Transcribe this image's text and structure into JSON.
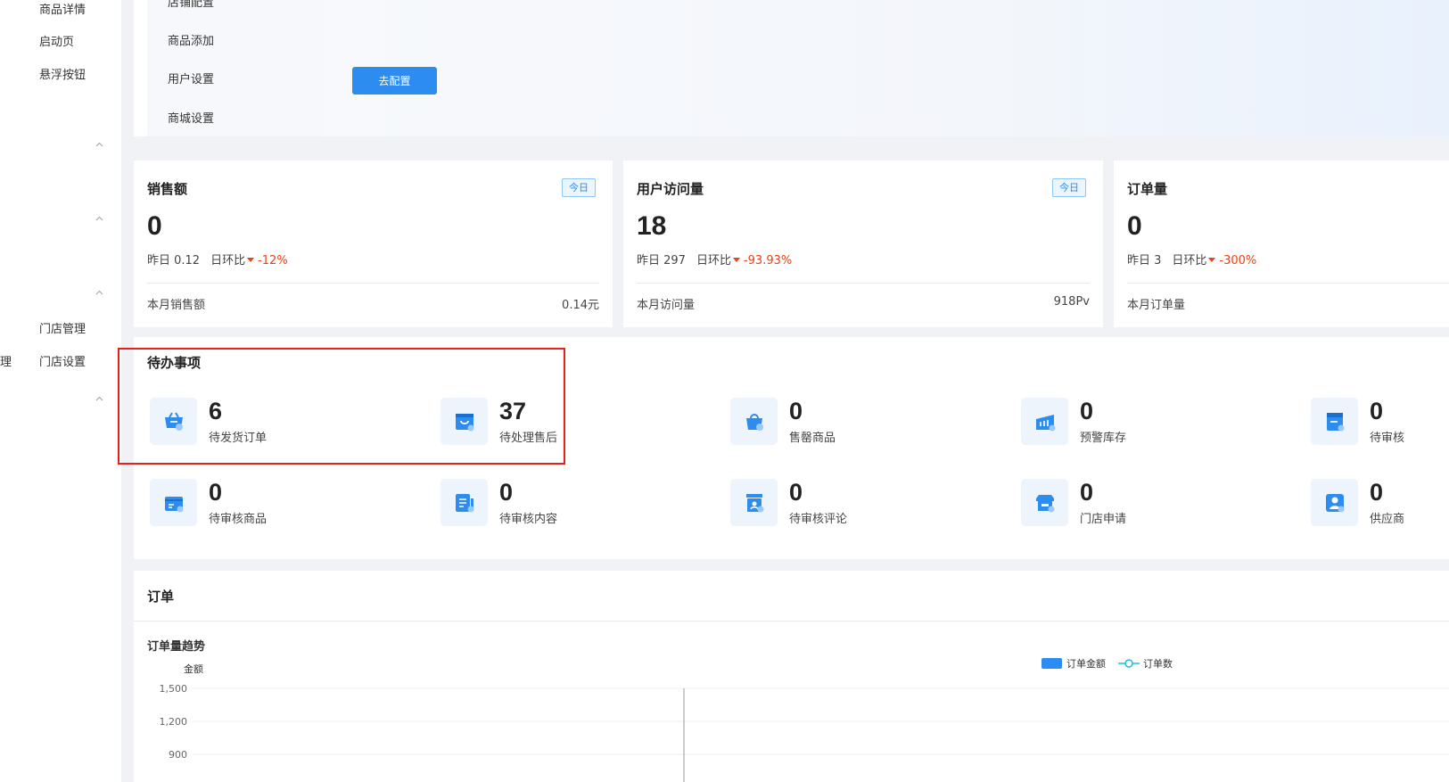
{
  "sidebar": {
    "items": [
      "商品详情",
      "启动页",
      "悬浮按钮",
      "门店管理",
      "门店设置"
    ],
    "cut_item": "理"
  },
  "config": {
    "menu": [
      "店铺配置",
      "商品添加",
      "用户设置",
      "商城设置"
    ],
    "button": "去配置"
  },
  "stats": [
    {
      "title": "销售额",
      "tag": "今日",
      "value": "0",
      "yesterday": "昨日 0.12",
      "ratio_label": "日环比",
      "ratio": "-12%",
      "foot_label": "本月销售额",
      "foot_value": "0.14元"
    },
    {
      "title": "用户访问量",
      "tag": "今日",
      "value": "18",
      "yesterday": "昨日 297",
      "ratio_label": "日环比",
      "ratio": "-93.93%",
      "foot_label": "本月访问量",
      "foot_value": "918Pv"
    },
    {
      "title": "订单量",
      "value": "0",
      "yesterday": "昨日 3",
      "ratio_label": "日环比",
      "ratio": "-300%",
      "foot_label": "本月订单量"
    }
  ],
  "todo": {
    "title": "待办事项",
    "items": [
      {
        "num": "6",
        "label": "待发货订单",
        "icon": "cart-icon"
      },
      {
        "num": "37",
        "label": "待处理售后",
        "icon": "bag-icon"
      },
      {
        "num": "0",
        "label": "售罄商品",
        "icon": "basket-icon"
      },
      {
        "num": "0",
        "label": "预警库存",
        "icon": "warehouse-icon"
      },
      {
        "num": "0",
        "label": "待审核",
        "icon": "document-icon"
      },
      {
        "num": "0",
        "label": "待审核商品",
        "icon": "product-box-icon"
      },
      {
        "num": "0",
        "label": "待审核内容",
        "icon": "content-icon"
      },
      {
        "num": "0",
        "label": "待审核评论",
        "icon": "comment-icon"
      },
      {
        "num": "0",
        "label": "门店申请",
        "icon": "store-icon"
      },
      {
        "num": "0",
        "label": "供应商",
        "icon": "supplier-icon"
      }
    ]
  },
  "order": {
    "title": "订单",
    "subtitle": "订单量趋势"
  },
  "chart_data": {
    "type": "bar",
    "ylabel": "金额",
    "yticks": [
      "1,500",
      "1,200",
      "900"
    ],
    "ylim": [
      900,
      1500
    ],
    "grid": true,
    "legend": "top-center",
    "series": [
      {
        "name": "订单金额",
        "kind": "bar",
        "color": "#2d8cf0"
      },
      {
        "name": "订单数",
        "kind": "line",
        "color": "#19c0d4"
      }
    ]
  },
  "colors": {
    "primary": "#2d8cf0",
    "down": "#ed4014",
    "highlight": "#e8201a"
  }
}
